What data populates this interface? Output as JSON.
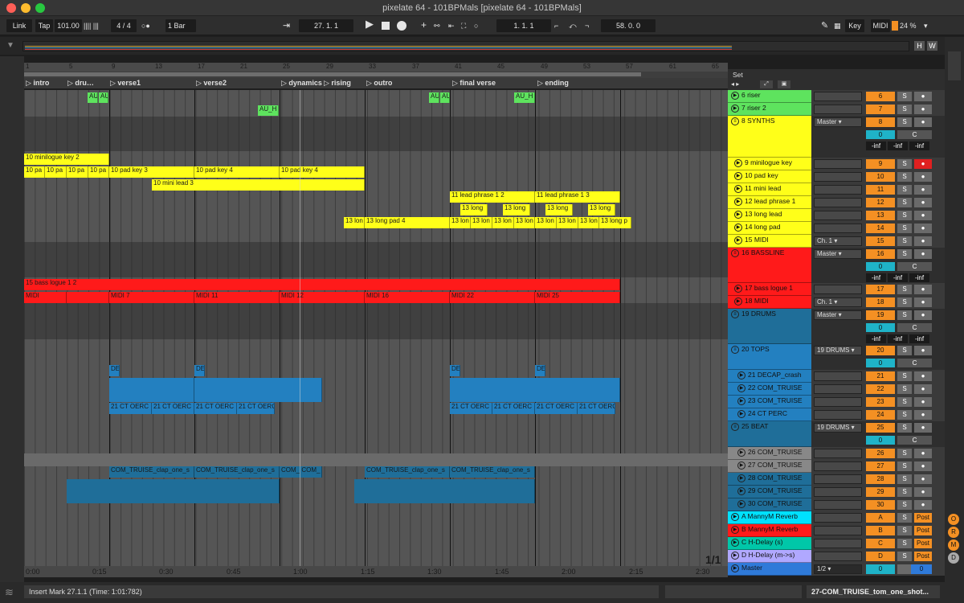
{
  "window": {
    "title": "pixelate 64 - 101BPMals  [pixelate 64 - 101BPMals]"
  },
  "transport": {
    "link": "Link",
    "tap": "Tap",
    "tempo": "101.00",
    "meter_bars": "|||| |||",
    "time_signature": "4 / 4",
    "metronome": "○●",
    "quantize": "1 Bar",
    "arrangement_position": "27.  1.  1",
    "loop_start": "1.  1.  1",
    "loop_length": "58.  0.  0",
    "key": "Key",
    "midi": "MIDI",
    "cpu": "24 %"
  },
  "overview": {
    "h_btn": "H",
    "w_btn": "W"
  },
  "ruler": {
    "bars": [
      "1",
      "5",
      "9",
      "13",
      "17",
      "21",
      "25",
      "29",
      "33",
      "37",
      "41",
      "45",
      "49",
      "53",
      "57",
      "61",
      "65"
    ]
  },
  "markers": [
    "intro",
    "dru…",
    "verse1",
    "verse2",
    "dynamics",
    "rising",
    "outro",
    "final verse",
    "ending"
  ],
  "timeline": {
    "labels": [
      "0:00",
      "0:15",
      "0:30",
      "0:45",
      "1:00",
      "1:15",
      "1:30",
      "1:45",
      "2:00",
      "2:15",
      "2:30"
    ]
  },
  "page_counter": "1/1",
  "clips": {
    "riser1": "AU_H",
    "riser2": "AU_H",
    "riser3": "AU_H",
    "riser4": "AU_H",
    "riser_short": "AU_H",
    "minilogue": "10 minilogue key 2",
    "pad_a": "10 pa",
    "pad_b": "10 pa",
    "pad_c": "10 pa",
    "pad_d": "10 pa",
    "pad3": "10 pad key 3",
    "pad4a": "10 pad key 4",
    "pad4b": "10 pad key 4",
    "minilead": "10 mini lead 3",
    "lead12": "11 lead phrase 1 2",
    "lead13": "11 lead phrase 1 3",
    "long": "13 long",
    "longpad4": "13 long pad 4",
    "longlon": "13 lon",
    "longpad_p": "13 long p",
    "bass": "15 bass logue 1 2",
    "midi": "MIDI",
    "midi7": "MIDI 7",
    "midi11": "MIDI 11",
    "midi12": "MIDI 12",
    "midi16": "MIDI 16",
    "midi22": "MIDI 22",
    "midi25": "MIDI 25",
    "decap": "DE",
    "perc": "21 CT OERC",
    "perc_short": "21 CT OERC",
    "clap": "COM_TRUISE_clap_one_s",
    "clap_short": "COM_ COM_"
  },
  "mixer": {
    "set_label": "Set",
    "tracks": [
      {
        "name": "6 riser",
        "color": "#5ee35e",
        "io": "",
        "num": "6"
      },
      {
        "name": "7 riser 2",
        "color": "#5ee35e",
        "io": "",
        "num": "7"
      },
      {
        "name": "8 SYNTHS",
        "color": "#ffff19",
        "io": "Master",
        "num": "8",
        "group": true
      },
      {
        "name": "9 minilogue key",
        "color": "#ffff19",
        "io": "",
        "num": "9"
      },
      {
        "name": "10 pad key",
        "color": "#ffff19",
        "io": "",
        "num": "10"
      },
      {
        "name": "11 mini lead",
        "color": "#ffff19",
        "io": "",
        "num": "11"
      },
      {
        "name": "12 lead phrase 1",
        "color": "#ffff19",
        "io": "",
        "num": "12"
      },
      {
        "name": "13 long lead",
        "color": "#ffff19",
        "io": "",
        "num": "13"
      },
      {
        "name": "14 long pad",
        "color": "#ffff19",
        "io": "",
        "num": "14"
      },
      {
        "name": "15 MIDI",
        "color": "#ffff19",
        "io": "Ch. 1",
        "num": "15"
      },
      {
        "name": "16 BASSLINE",
        "color": "#ff1a1a",
        "io": "Master",
        "num": "16",
        "group": true
      },
      {
        "name": "17 bass logue 1",
        "color": "#ff1a1a",
        "io": "",
        "num": "17"
      },
      {
        "name": "18 MIDI",
        "color": "#ff1a1a",
        "io": "Ch. 1",
        "num": "18"
      },
      {
        "name": "19 DRUMS",
        "color": "#1f6e99",
        "io": "Master",
        "num": "19",
        "group": true
      },
      {
        "name": "20 TOPS",
        "color": "#2380c0",
        "io": "19 DRUMS",
        "num": "20",
        "group": true
      },
      {
        "name": "21 DECAP_crash",
        "color": "#2380c0",
        "io": "",
        "num": "21"
      },
      {
        "name": "22 COM_TRUISE",
        "color": "#2380c0",
        "io": "",
        "num": "22"
      },
      {
        "name": "23 COM_TRUISE",
        "color": "#2380c0",
        "io": "",
        "num": "23"
      },
      {
        "name": "24 CT PERC",
        "color": "#2380c0",
        "io": "",
        "num": "24"
      },
      {
        "name": "25 BEAT",
        "color": "#1f6e99",
        "io": "19 DRUMS",
        "num": "25",
        "group": true
      },
      {
        "name": "26 COM_TRUISE",
        "color": "#888888",
        "io": "",
        "num": "26"
      },
      {
        "name": "27 COM_TRUISE",
        "color": "#888888",
        "io": "",
        "num": "27"
      },
      {
        "name": "28 COM_TRUISE",
        "color": "#1f6e99",
        "io": "",
        "num": "28"
      },
      {
        "name": "29 COM_TRUISE",
        "color": "#1f6e99",
        "io": "",
        "num": "29"
      },
      {
        "name": "30 COM_TRUISE",
        "color": "#1f6e99",
        "io": "",
        "num": "30"
      },
      {
        "name": "A MannyM Reverb",
        "color": "#00e1ff",
        "io": "",
        "num": "A",
        "ret": true
      },
      {
        "name": "B MannyM Reverb",
        "color": "#ff1a1a",
        "io": "",
        "num": "B",
        "ret": true
      },
      {
        "name": "C H-Delay (s)",
        "color": "#00c7a8",
        "io": "",
        "num": "C",
        "ret": true
      },
      {
        "name": "D H-Delay (m->s)",
        "color": "#b0a8ff",
        "io": "",
        "num": "D",
        "ret": true
      },
      {
        "name": "Master",
        "color": "#2f7ad9",
        "io": "1/2",
        "num": "0",
        "master": true
      }
    ],
    "zero": "0",
    "center": "C",
    "inf": "-inf",
    "solo": "S",
    "post": "Post"
  },
  "status": {
    "message": "Insert Mark 27.1.1 (Time: 1:01:782)",
    "clip_name": "27-COM_TRUISE_tom_one_shot..."
  },
  "right_side": {
    "r1": "O",
    "r2": "R",
    "r3": "D"
  }
}
